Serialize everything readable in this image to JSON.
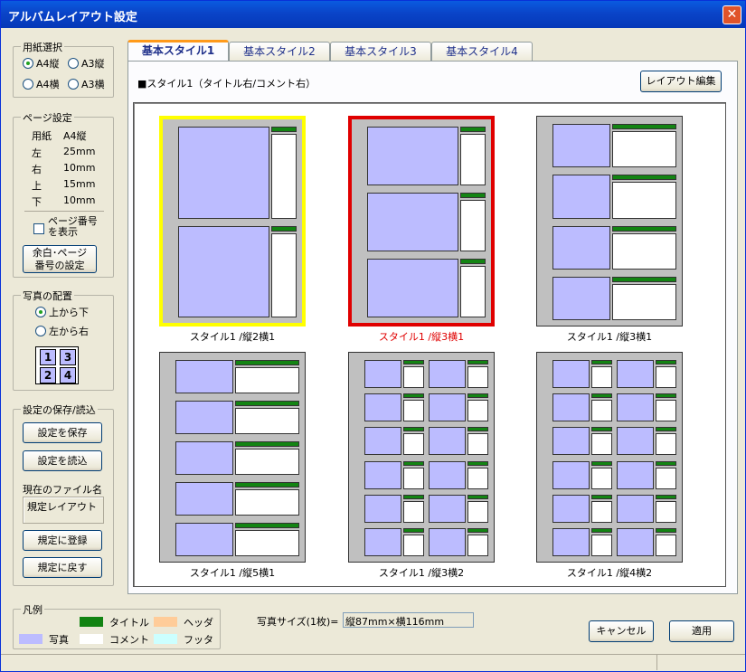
{
  "window": {
    "title": "アルバムレイアウト設定",
    "close_label": "✕"
  },
  "paper": {
    "legend": "用紙選択",
    "options": [
      "A4縦",
      "A3縦",
      "A4横",
      "A3横"
    ],
    "selected": "A4縦"
  },
  "page_settings": {
    "legend": "ページ設定",
    "rows": [
      {
        "label": "用紙",
        "value": "A4縦"
      },
      {
        "label": "左",
        "value": "25mm"
      },
      {
        "label": "右",
        "value": "10mm"
      },
      {
        "label": "上",
        "value": "15mm"
      },
      {
        "label": "下",
        "value": "10mm"
      }
    ],
    "show_page_number_label_1": "ページ番号",
    "show_page_number_label_2": "を表示",
    "show_page_number_checked": false,
    "margin_button_1": "余白･ページ",
    "margin_button_2": "番号の設定"
  },
  "photo_order": {
    "legend": "写真の配置",
    "options": [
      "上から下",
      "左から右"
    ],
    "selected": "上から下",
    "grid": [
      "1",
      "3",
      "2",
      "4"
    ]
  },
  "save_load": {
    "legend": "設定の保存/読込",
    "save_button": "設定を保存",
    "load_button": "設定を読込",
    "current_file_label": "現在のファイル名",
    "current_file_value": "規定レイアウト",
    "register_button": "規定に登録",
    "restore_button": "規定に戻す"
  },
  "tabs": [
    {
      "label": "基本スタイル1",
      "active": true
    },
    {
      "label": "基本スタイル2",
      "active": false
    },
    {
      "label": "基本スタイル3",
      "active": false
    },
    {
      "label": "基本スタイル4",
      "active": false
    }
  ],
  "panel": {
    "heading": "■スタイル1（タイトル右/コメント右）",
    "edit_button": "レイアウト編集"
  },
  "layouts": [
    {
      "caption": "スタイル1 /縦2横1",
      "cols": 1,
      "rows": 2,
      "highlight": "#ffff00",
      "selected": false
    },
    {
      "caption": "スタイル1 /縦3横1",
      "cols": 1,
      "rows": 3,
      "highlight": "#e00000",
      "selected": true
    },
    {
      "caption": "スタイル1 /縦3横1",
      "cols": 1,
      "rows": 4,
      "highlight": "",
      "selected": false
    },
    {
      "caption": "スタイル1 /縦5横1",
      "cols": 1,
      "rows": 5,
      "highlight": "",
      "selected": false
    },
    {
      "caption": "スタイル1 /縦3横2",
      "cols": 2,
      "rows": 6,
      "highlight": "",
      "selected": false
    },
    {
      "caption": "スタイル1 /縦4横2",
      "cols": 2,
      "rows": 6,
      "highlight": "",
      "selected": false
    }
  ],
  "legend_box": {
    "legend": "凡例",
    "items": [
      {
        "label": "タイトル",
        "color": "#138413"
      },
      {
        "label": "ヘッダ",
        "color": "#ffcc99"
      },
      {
        "label": "写真",
        "color": "#bcbcff"
      },
      {
        "label": "コメント",
        "color": "#ffffff"
      },
      {
        "label": "フッタ",
        "color": "#ccffff"
      }
    ]
  },
  "photo_size": {
    "label": "写真サイズ(1枚)=",
    "value": "縦87mm×横116mm"
  },
  "buttons": {
    "cancel": "キャンセル",
    "apply": "適用"
  }
}
